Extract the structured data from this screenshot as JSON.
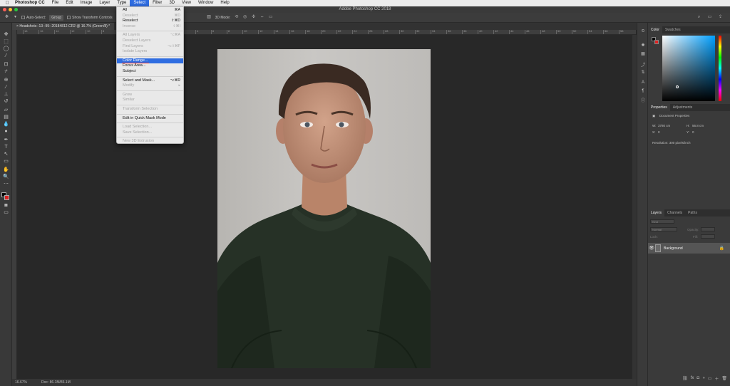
{
  "menubar": {
    "apple": "",
    "app_name": "Photoshop CC",
    "items": [
      "File",
      "Edit",
      "Image",
      "Layer",
      "Type",
      "Select",
      "Filter",
      "3D",
      "View",
      "Window",
      "Help"
    ],
    "active_item": "Select"
  },
  "window": {
    "title": "Adobe Photoshop CC 2018"
  },
  "options_bar": {
    "auto_select_label": "Auto-Select:",
    "auto_select_value": "Group",
    "show_transform_label": "Show Transform Controls",
    "mode_label": "3D Mode:"
  },
  "document_tab": {
    "label": "Headshots--13--99--20184812.CR2 @ 16.7% (Green/8) *"
  },
  "ruler_ticks": [
    "18",
    "16",
    "14",
    "12",
    "10",
    "8",
    "6",
    "4",
    "2",
    "0",
    "2",
    "4",
    "6",
    "8",
    "10",
    "12",
    "14",
    "16",
    "18",
    "20",
    "22",
    "24",
    "26",
    "28",
    "30",
    "32",
    "34",
    "36",
    "38",
    "40",
    "42",
    "44",
    "46",
    "48",
    "50",
    "52",
    "54",
    "56",
    "58"
  ],
  "status_bar": {
    "zoom": "16.67%",
    "doc_info": "Doc: 86.1M/86.1M"
  },
  "select_menu": {
    "items": [
      {
        "label": "All",
        "shortcut": "⌘A",
        "disabled": false
      },
      {
        "label": "Deselect",
        "shortcut": "⌘D",
        "disabled": true
      },
      {
        "label": "Reselect",
        "shortcut": "⇧⌘D",
        "disabled": false
      },
      {
        "label": "Inverse",
        "shortcut": "⇧⌘I",
        "disabled": true
      },
      {
        "sep": true
      },
      {
        "label": "All Layers",
        "shortcut": "⌥⌘A",
        "disabled": true
      },
      {
        "label": "Deselect Layers",
        "shortcut": "",
        "disabled": true
      },
      {
        "label": "Find Layers",
        "shortcut": "⌥⇧⌘F",
        "disabled": true
      },
      {
        "label": "Isolate Layers",
        "shortcut": "",
        "disabled": true
      },
      {
        "sep": true
      },
      {
        "label": "Color Range...",
        "shortcut": "",
        "disabled": false,
        "highlighted": true
      },
      {
        "label": "Focus Area...",
        "shortcut": "",
        "disabled": false
      },
      {
        "label": "Subject",
        "shortcut": "",
        "disabled": false
      },
      {
        "sep": true
      },
      {
        "label": "Select and Mask...",
        "shortcut": "⌥⌘R",
        "disabled": false
      },
      {
        "label": "Modify",
        "shortcut": "▸",
        "disabled": true
      },
      {
        "sep": true
      },
      {
        "label": "Grow",
        "shortcut": "",
        "disabled": true
      },
      {
        "label": "Similar",
        "shortcut": "",
        "disabled": true
      },
      {
        "sep": true
      },
      {
        "label": "Transform Selection",
        "shortcut": "",
        "disabled": true
      },
      {
        "sep": true
      },
      {
        "label": "Edit in Quick Mask Mode",
        "shortcut": "",
        "disabled": false
      },
      {
        "sep": true
      },
      {
        "label": "Load Selection...",
        "shortcut": "",
        "disabled": true
      },
      {
        "label": "Save Selection...",
        "shortcut": "",
        "disabled": true
      },
      {
        "sep": true
      },
      {
        "label": "New 3D Extrusion",
        "shortcut": "",
        "disabled": true
      }
    ]
  },
  "color_panel": {
    "tabs": [
      "Color",
      "Swatches"
    ],
    "active_tab": "Color"
  },
  "properties_panel": {
    "tabs": [
      "Properties",
      "Adjustments"
    ],
    "active_tab": "Properties",
    "section_title": "Document Properties",
    "w_label": "W:",
    "w_value": "3780 cm",
    "h_label": "H:",
    "h_value": "56.8 cm",
    "x_label": "X:",
    "x_value": "0",
    "y_label": "Y:",
    "y_value": "0",
    "resolution": "Resolution: 300 pixels/inch"
  },
  "layers_panel": {
    "tabs": [
      "Layers",
      "Channels",
      "Paths"
    ],
    "active_tab": "Layers",
    "filter_label": "Kind",
    "blend_mode": "Normal",
    "opacity_label": "Opacity:",
    "lock_label": "Lock:",
    "fill_label": "Fill:",
    "layer_name": "Background"
  },
  "colors": {
    "menu_highlight": "#2f6de1",
    "foreground": "#000000",
    "background": "#ffffff",
    "accent_red": "#e0303a"
  }
}
